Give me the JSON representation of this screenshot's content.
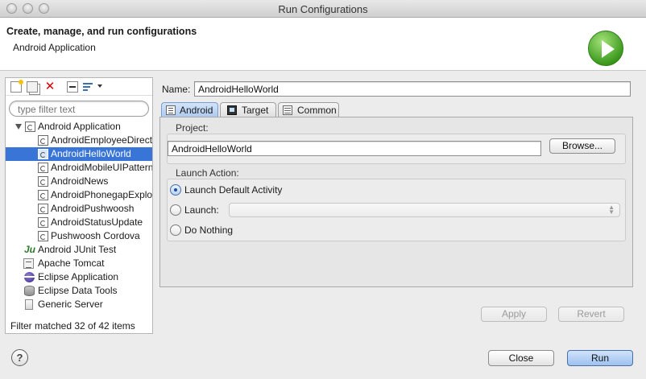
{
  "window": {
    "title": "Run Configurations"
  },
  "header": {
    "title": "Create, manage, and run configurations",
    "subtitle": "Android Application"
  },
  "filter": {
    "placeholder": "type filter text"
  },
  "tree": {
    "items": [
      {
        "label": "Android Application",
        "icon": "android-app-icon",
        "level": 0,
        "expanded": true,
        "selected": false
      },
      {
        "label": "AndroidEmployeeDirectory",
        "icon": "android-config-icon",
        "level": 1,
        "selected": false
      },
      {
        "label": "AndroidHelloWorld",
        "icon": "android-config-icon",
        "level": 1,
        "selected": true
      },
      {
        "label": "AndroidMobileUIPatterns",
        "icon": "android-config-icon",
        "level": 1,
        "selected": false
      },
      {
        "label": "AndroidNews",
        "icon": "android-config-icon",
        "level": 1,
        "selected": false
      },
      {
        "label": "AndroidPhonegapExplorer",
        "icon": "android-config-icon",
        "level": 1,
        "selected": false
      },
      {
        "label": "AndroidPushwoosh",
        "icon": "android-config-icon",
        "level": 1,
        "selected": false
      },
      {
        "label": "AndroidStatusUpdate",
        "icon": "android-config-icon",
        "level": 1,
        "selected": false
      },
      {
        "label": "Pushwoosh Cordova",
        "icon": "android-config-icon",
        "level": 1,
        "selected": false
      },
      {
        "label": "Android JUnit Test",
        "icon": "junit-icon",
        "level": 0,
        "selected": false
      },
      {
        "label": "Apache Tomcat",
        "icon": "tomcat-icon",
        "level": 0,
        "selected": false
      },
      {
        "label": "Eclipse Application",
        "icon": "eclipse-icon",
        "level": 0,
        "selected": false
      },
      {
        "label": "Eclipse Data Tools",
        "icon": "database-icon",
        "level": 0,
        "selected": false
      },
      {
        "label": "Generic Server",
        "icon": "server-icon",
        "level": 0,
        "selected": false
      }
    ],
    "status": "Filter matched 32 of 42 items"
  },
  "config": {
    "name_label": "Name:",
    "name_value": "AndroidHelloWorld",
    "tabs": [
      {
        "label": "Android",
        "icon": "android-tab-icon",
        "active": true
      },
      {
        "label": "Target",
        "icon": "target-tab-icon",
        "active": false
      },
      {
        "label": "Common",
        "icon": "common-tab-icon",
        "active": false
      }
    ],
    "project_label": "Project:",
    "project_value": "AndroidHelloWorld",
    "browse_label": "Browse...",
    "launch_action_label": "Launch Action:",
    "launch_options": [
      {
        "label": "Launch Default Activity",
        "checked": true
      },
      {
        "label": "Launch:",
        "checked": false
      },
      {
        "label": "Do Nothing",
        "checked": false
      }
    ],
    "launch_activity_value": "",
    "apply_label": "Apply",
    "revert_label": "Revert"
  },
  "footer": {
    "close_label": "Close",
    "run_label": "Run",
    "help_symbol": "?"
  },
  "colors": {
    "selection": "#3875d7",
    "run_green": "#3d9a1e",
    "primary_button": "#9ec1ef"
  }
}
